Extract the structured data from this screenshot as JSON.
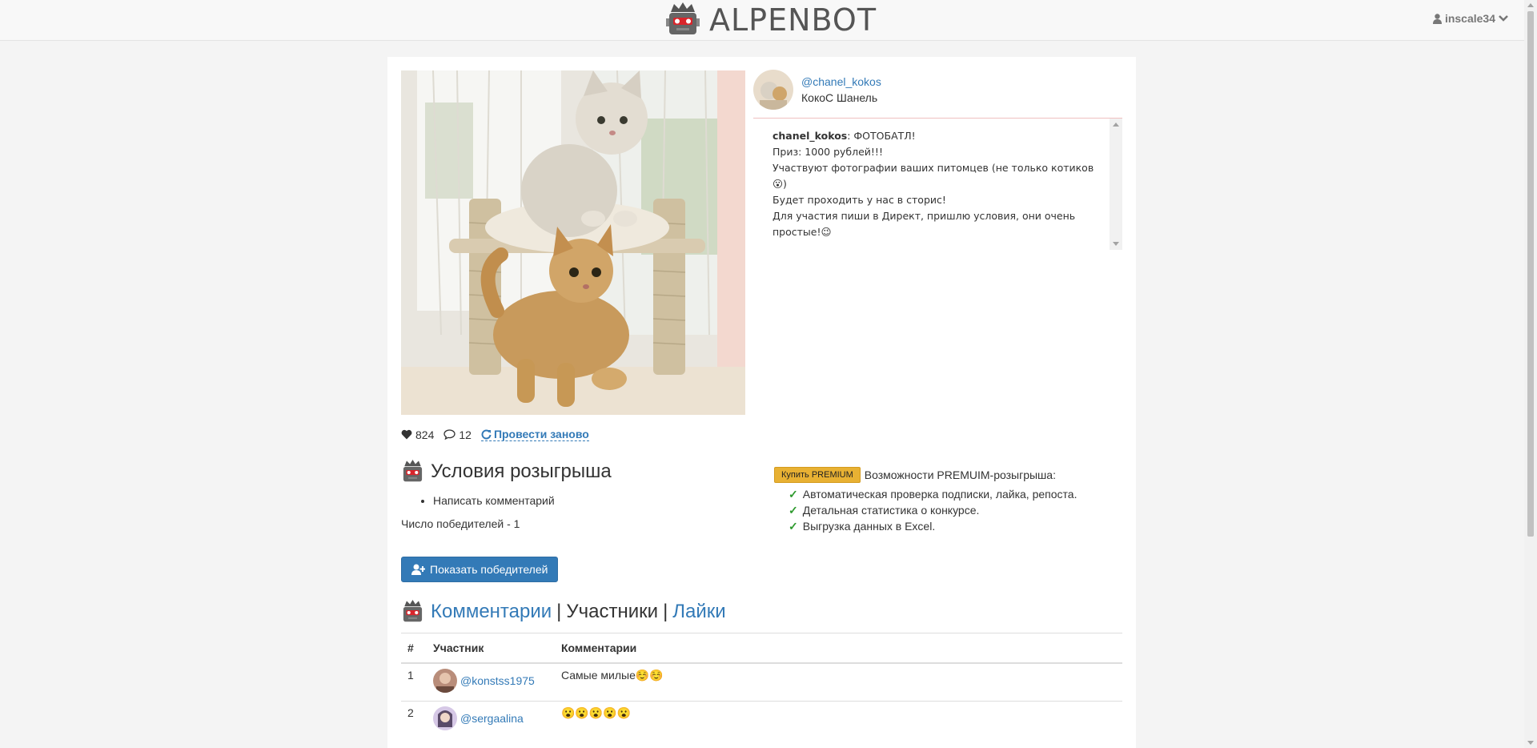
{
  "header": {
    "brand": "ALPENBOT",
    "username": "inscale34"
  },
  "post": {
    "author_handle": "@chanel_kokos",
    "author_name": "КокоС Шанель",
    "caption_user": "chanel_kokos",
    "caption_lines": [
      ": ФОТОБАТЛ!",
      "Приз: 1000 рублей!!!",
      "Участвуют фотографии ваших питомцев (не только котиков",
      "😮)",
      "Будет проходить у нас в сторис!",
      "Для участия пиши в Директ, пришлю условия, они очень",
      "простые!😉"
    ],
    "likes": "824",
    "comments": "12",
    "rerun_label": "Провести заново"
  },
  "conditions": {
    "title": "Условия розыгрыша",
    "items": [
      "Написать комментарий"
    ],
    "winners_count": "Число победителей - 1"
  },
  "premium": {
    "button_label": "Купить PREMIUM",
    "heading": "Возможности PREMUIM-розыгрыша:",
    "features": [
      "Автоматическая проверка подписки, лайка, репоста.",
      "Детальная статистика о конкурсе.",
      "Выгрузка данных в Excel."
    ]
  },
  "show_winners_label": "Показать победителей",
  "tabs": {
    "comments": "Комментарии",
    "participants": "Участники",
    "likes": "Лайки",
    "separator": "|"
  },
  "table": {
    "headers": [
      "#",
      "Участник",
      "Комментарии"
    ],
    "rows": [
      {
        "index": "1",
        "user": "@konstss1975",
        "comment": "Самые милые☺️☺️"
      },
      {
        "index": "2",
        "user": "@sergaalina",
        "comment": "😮😮😮😮😮"
      }
    ]
  },
  "colors": {
    "link": "#337ab7",
    "primary_button": "#337ab7",
    "premium_button": "#e8b133",
    "check": "#2e9a2e"
  },
  "icons": [
    "robot-icon",
    "user-icon",
    "chevron-down-icon",
    "heart-icon",
    "comment-icon",
    "refresh-icon",
    "check-icon",
    "user-plus-icon"
  ]
}
